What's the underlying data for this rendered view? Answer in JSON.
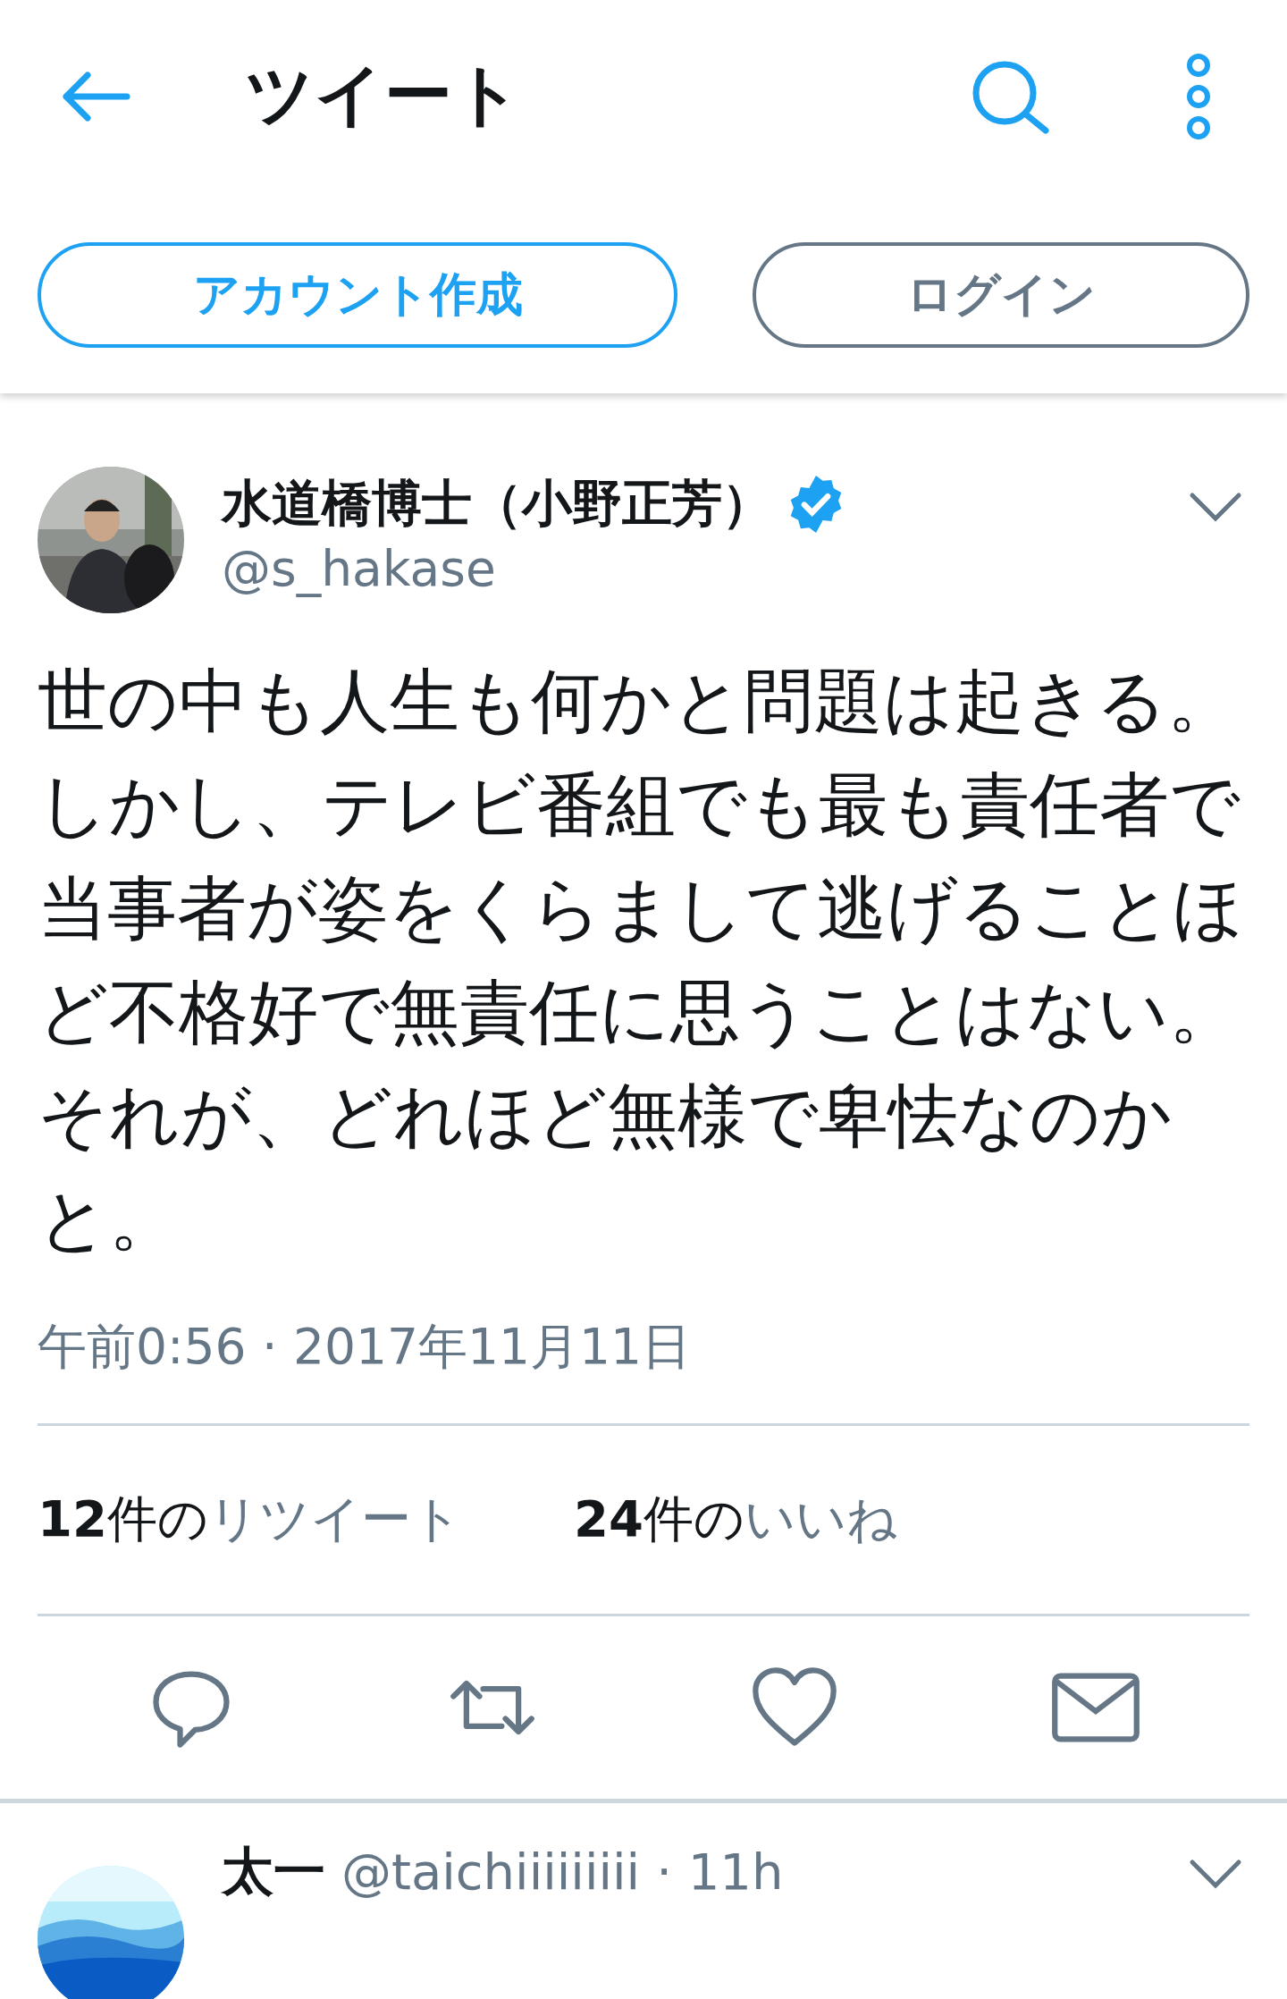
{
  "header": {
    "title": "ツイート",
    "buttons": [
      {
        "label": "アカウント作成",
        "kind": "primary"
      },
      {
        "label": "ログイン",
        "kind": "secondary"
      }
    ]
  },
  "tweet": {
    "name": "水道橋博士（小野正芳）",
    "verified": true,
    "handle": "@s_hakase",
    "text": "世の中も人生も何かと問題は起きる。しかし、テレビ番組でも最も責任者で当事者が姿をくらまして逃げることほど不格好で無責任に思うことはない。それが、どれほど無様で卑怯なのかと。",
    "timestamp": "午前0:56 · 2017年11月11日",
    "stats": [
      {
        "count": "**12**件の",
        "label": "リツイート"
      },
      {
        "count": "**24**件の",
        "label": "いいね"
      }
    ]
  },
  "reply": {
    "name": "太一",
    "handle": "@taichiiiiiiiii",
    "time": "· 11h"
  }
}
